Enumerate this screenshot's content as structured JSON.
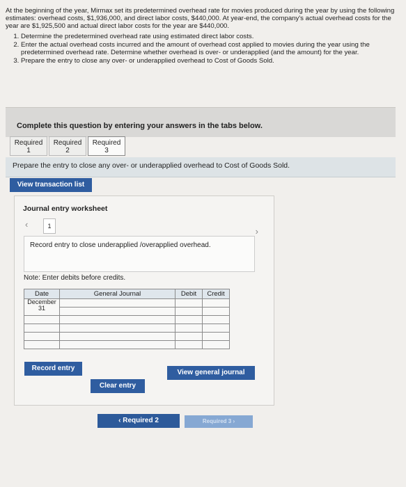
{
  "problem": {
    "intro": "At the beginning of the year, Mirmax set its predetermined overhead rate for movies produced during the year by using the following estimates: overhead costs, $1,936,000, and direct labor costs, $440,000. At year-end, the company's actual overhead costs for the year are $1,925,500 and actual direct labor costs for the year are $440,000.",
    "items": [
      "Determine the predetermined overhead rate using estimated direct labor costs.",
      "Enter the actual overhead costs incurred and the amount of overhead cost applied to movies during the year using the predetermined overhead rate. Determine whether overhead is over- or underapplied (and the amount) for the year.",
      "Prepare the entry to close any over- or underapplied overhead to Cost of Goods Sold."
    ]
  },
  "banner": "Complete this question by entering your answers in the tabs below.",
  "tabs": [
    {
      "line1": "Required",
      "line2": "1"
    },
    {
      "line1": "Required",
      "line2": "2"
    },
    {
      "line1": "Required",
      "line2": "3"
    }
  ],
  "instruction": "Prepare the entry to close any over- or underapplied overhead to Cost of Goods Sold.",
  "view_transaction_list": "View transaction list",
  "worksheet": {
    "title": "Journal entry worksheet",
    "page": "1",
    "record_text": "Record entry to close underapplied /overapplied overhead.",
    "note": "Note: Enter debits before credits.",
    "headers": {
      "date": "Date",
      "account": "General Journal",
      "debit": "Debit",
      "credit": "Credit"
    },
    "date_month": "December",
    "date_day": "31"
  },
  "buttons": {
    "record_entry": "Record entry",
    "clear_entry": "Clear entry",
    "view_general_journal": "View general journal",
    "prev": "Required 2",
    "next": "Required 3"
  }
}
